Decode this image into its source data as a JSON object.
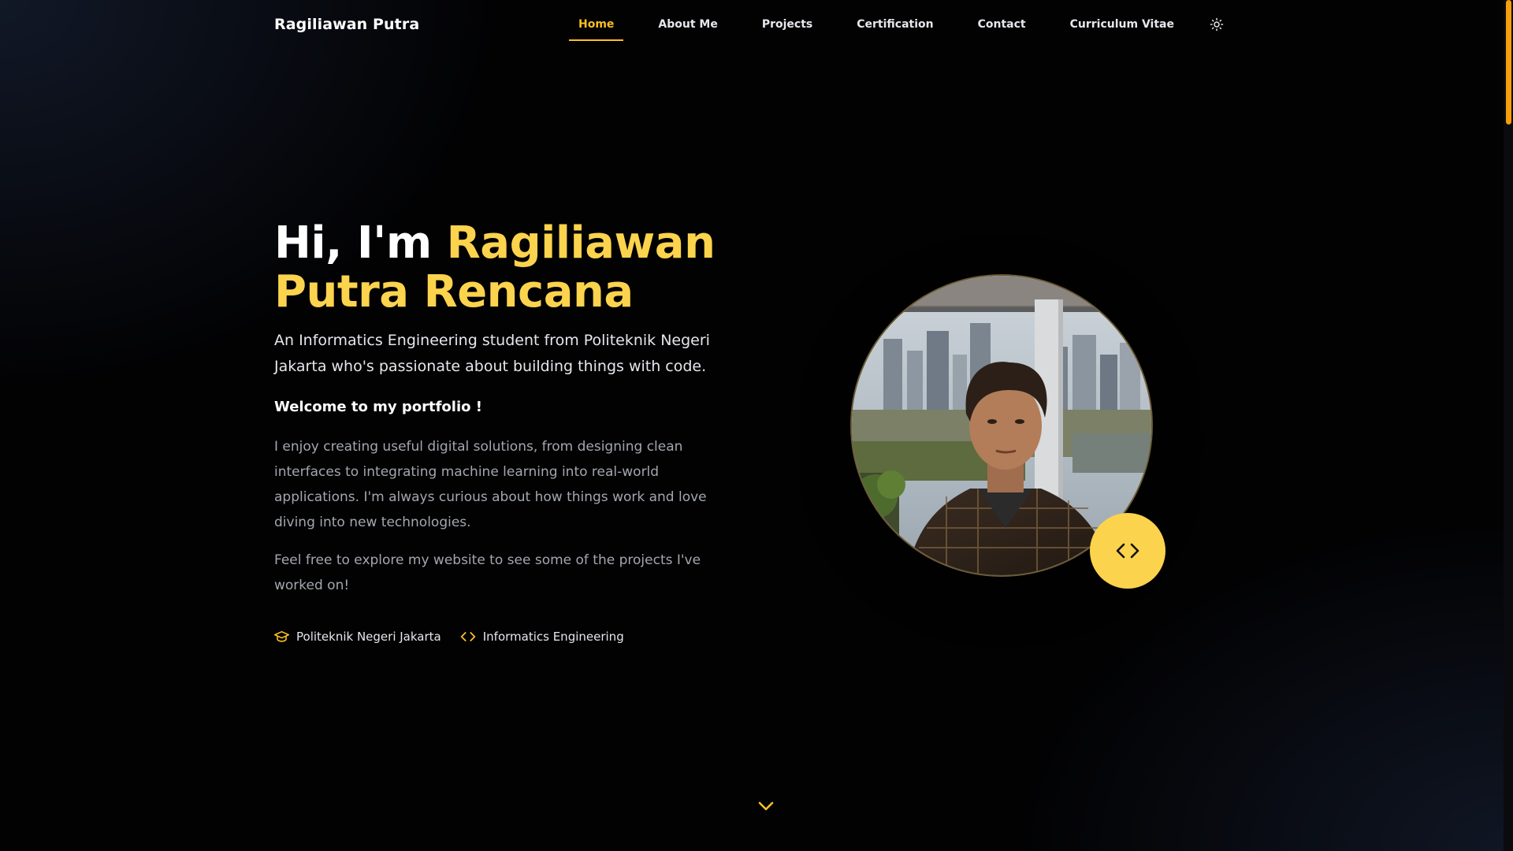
{
  "brand": "Ragiliawan Putra",
  "nav": {
    "links": [
      "Home",
      "About Me",
      "Projects",
      "Certification",
      "Contact",
      "Curriculum Vitae"
    ],
    "active": "Home",
    "theme_toggle_icon": "sun-icon"
  },
  "hero": {
    "greeting": "Hi, I'm ",
    "name": "Ragiliawan Putra Rencana",
    "subtitle": "An Informatics Engineering student from Politeknik Negeri Jakarta who's passionate about building things with code.",
    "welcome": "Welcome to my portfolio !",
    "paragraph1": "I enjoy creating useful digital solutions, from designing clean interfaces to integrating machine learning into real-world applications. I'm always curious about how things work and love diving into new technologies.",
    "paragraph2": "Feel free to explore my website to see some of the projects I've worked on!",
    "tags": [
      {
        "icon": "graduation-cap-icon",
        "label": "Politeknik Negeri Jakarta"
      },
      {
        "icon": "code-icon",
        "label": "Informatics Engineering"
      }
    ]
  },
  "photo": {
    "badge_icon": "code-icon"
  },
  "colors": {
    "accent": "#fcd34d",
    "accent_dark": "#fbbf24",
    "background": "#020203",
    "scrollbar_thumb": "#f59e0b"
  }
}
